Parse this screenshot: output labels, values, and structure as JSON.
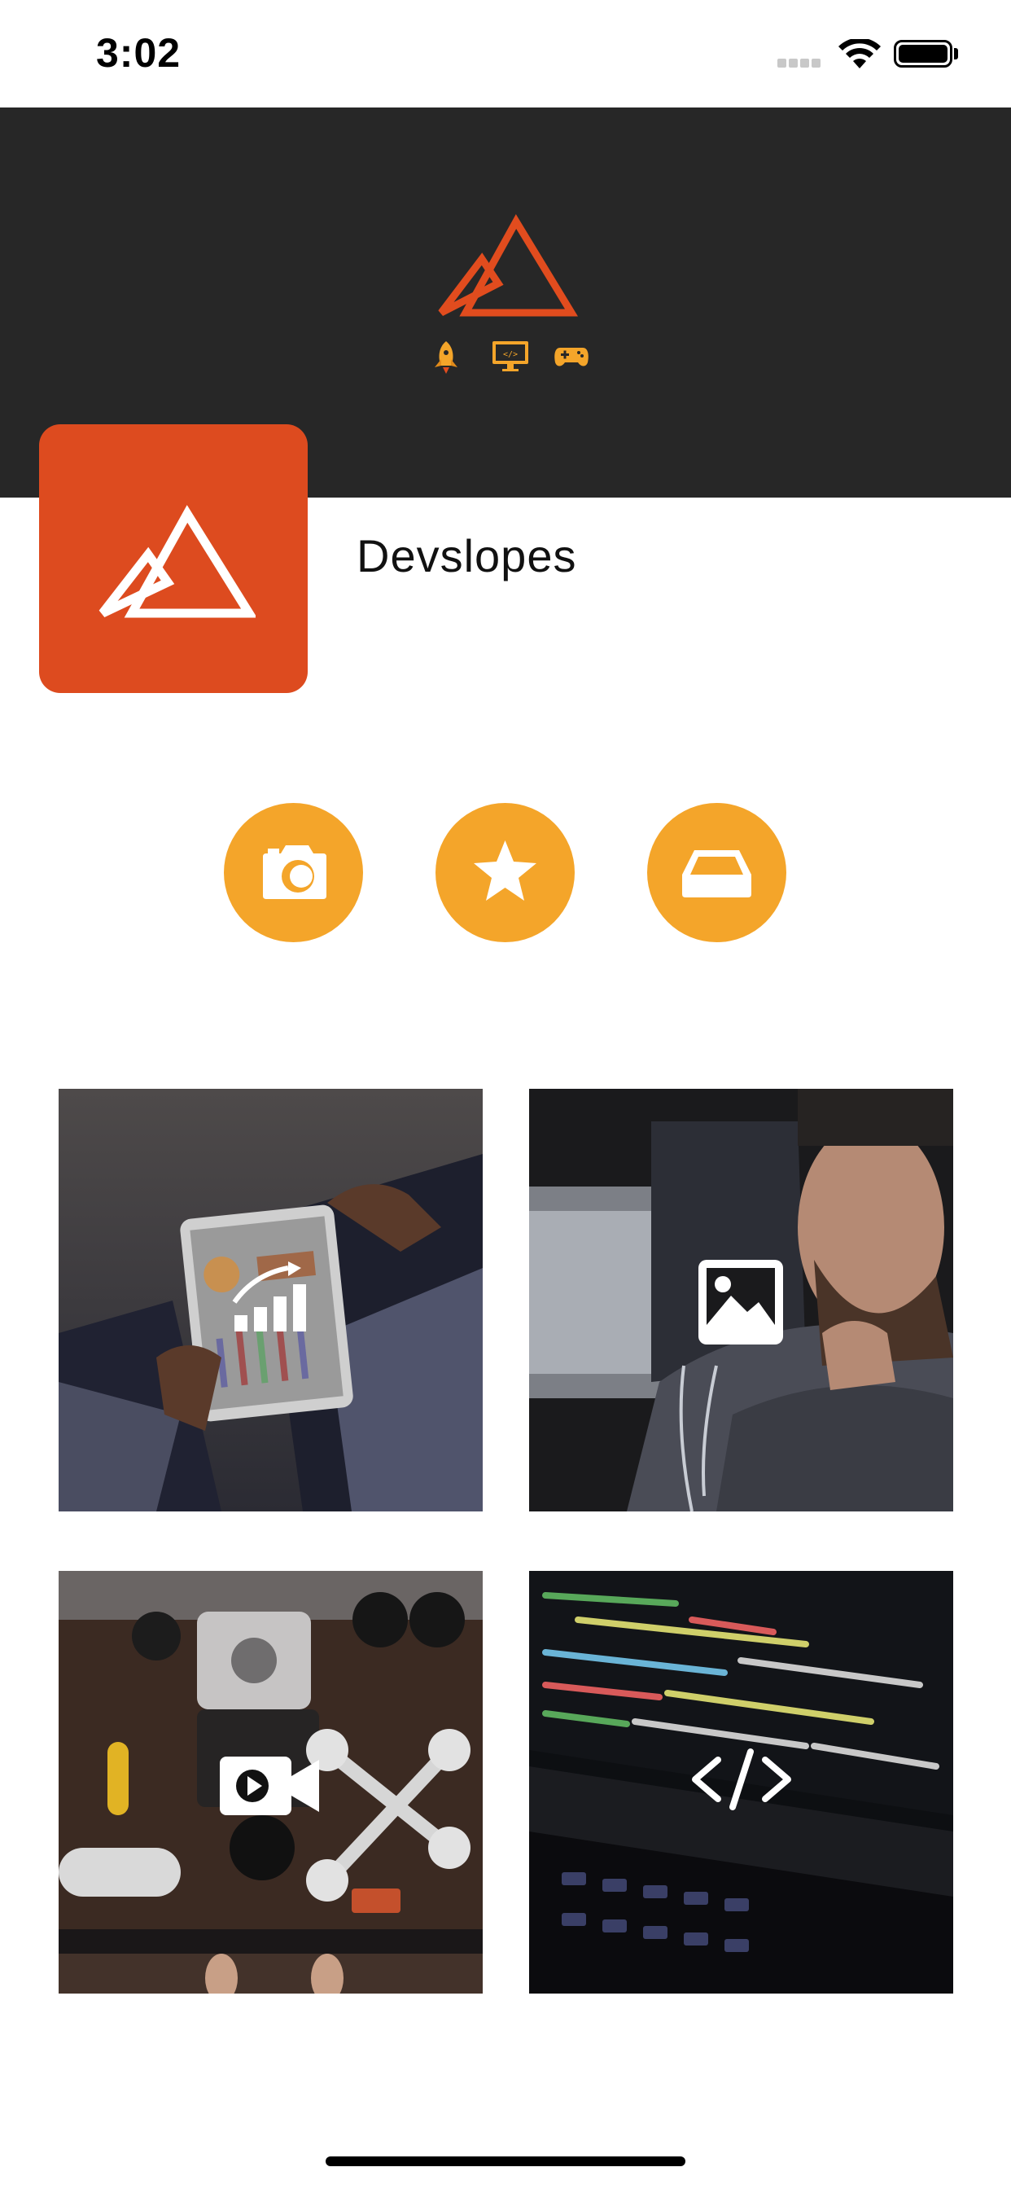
{
  "status": {
    "time": "3:02"
  },
  "profile": {
    "name": "Devslopes"
  },
  "colors": {
    "brand_orange": "#dd4b1f",
    "accent_yellow": "#f4a52a",
    "cover_dark": "#272727",
    "white": "#ffffff"
  },
  "cover": {
    "icons": [
      "rocket-icon",
      "code-monitor-icon",
      "gamepad-icon"
    ]
  },
  "actions": [
    {
      "icon": "camera-icon"
    },
    {
      "icon": "star-icon"
    },
    {
      "icon": "inbox-icon"
    }
  ],
  "tiles": [
    {
      "icon": "chart-icon",
      "photo": "tablet-analytics"
    },
    {
      "icon": "image-icon",
      "photo": "man-thinking"
    },
    {
      "icon": "video-camera-icon",
      "photo": "camera-gear-flatlay"
    },
    {
      "icon": "code-icon",
      "photo": "laptop-code"
    }
  ]
}
